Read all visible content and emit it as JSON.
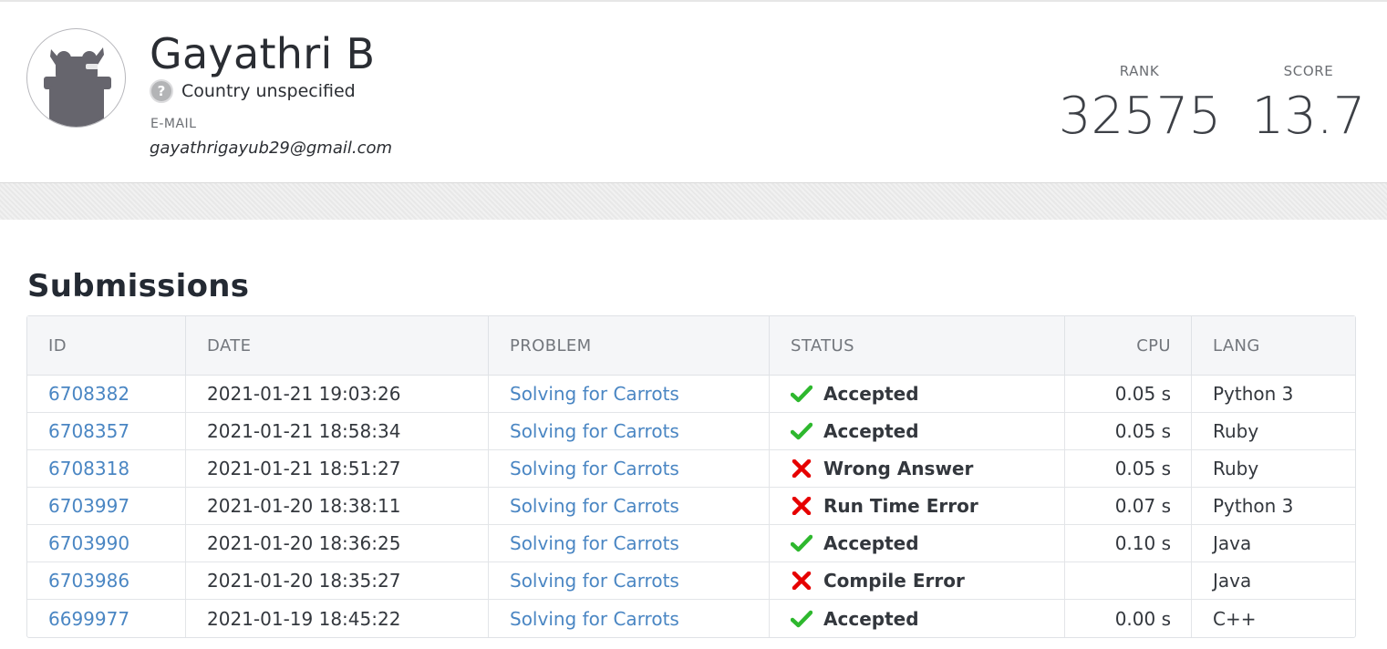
{
  "profile": {
    "name": "Gayathri B",
    "country": "Country unspecified",
    "email_label": "E-MAIL",
    "email": "gayathrigayub29@gmail.com",
    "rank_label": "RANK",
    "rank": "32575",
    "score_label": "SCORE",
    "score": "13.7"
  },
  "submissions": {
    "title": "Submissions",
    "columns": [
      "ID",
      "DATE",
      "PROBLEM",
      "STATUS",
      "CPU",
      "LANG"
    ],
    "rows": [
      {
        "id": "6708382",
        "date": "2021-01-21 19:03:26",
        "problem": "Solving for Carrots",
        "status": "Accepted",
        "ok": true,
        "cpu": "0.05 s",
        "lang": "Python 3"
      },
      {
        "id": "6708357",
        "date": "2021-01-21 18:58:34",
        "problem": "Solving for Carrots",
        "status": "Accepted",
        "ok": true,
        "cpu": "0.05 s",
        "lang": "Ruby"
      },
      {
        "id": "6708318",
        "date": "2021-01-21 18:51:27",
        "problem": "Solving for Carrots",
        "status": "Wrong Answer",
        "ok": false,
        "cpu": "0.05 s",
        "lang": "Ruby"
      },
      {
        "id": "6703997",
        "date": "2021-01-20 18:38:11",
        "problem": "Solving for Carrots",
        "status": "Run Time Error",
        "ok": false,
        "cpu": "0.07 s",
        "lang": "Python 3"
      },
      {
        "id": "6703990",
        "date": "2021-01-20 18:36:25",
        "problem": "Solving for Carrots",
        "status": "Accepted",
        "ok": true,
        "cpu": "0.10 s",
        "lang": "Java"
      },
      {
        "id": "6703986",
        "date": "2021-01-20 18:35:27",
        "problem": "Solving for Carrots",
        "status": "Compile Error",
        "ok": false,
        "cpu": "",
        "lang": "Java"
      },
      {
        "id": "6699977",
        "date": "2021-01-19 18:45:22",
        "problem": "Solving for Carrots",
        "status": "Accepted",
        "ok": true,
        "cpu": "0.00 s",
        "lang": "C++"
      }
    ]
  },
  "colors": {
    "accepted": "#2eb82e",
    "error": "#e60000",
    "link": "#4a86c3"
  },
  "icons": {
    "accepted": "check-icon",
    "error": "cross-icon",
    "country": "question-icon",
    "avatar": "default-avatar-icon"
  }
}
